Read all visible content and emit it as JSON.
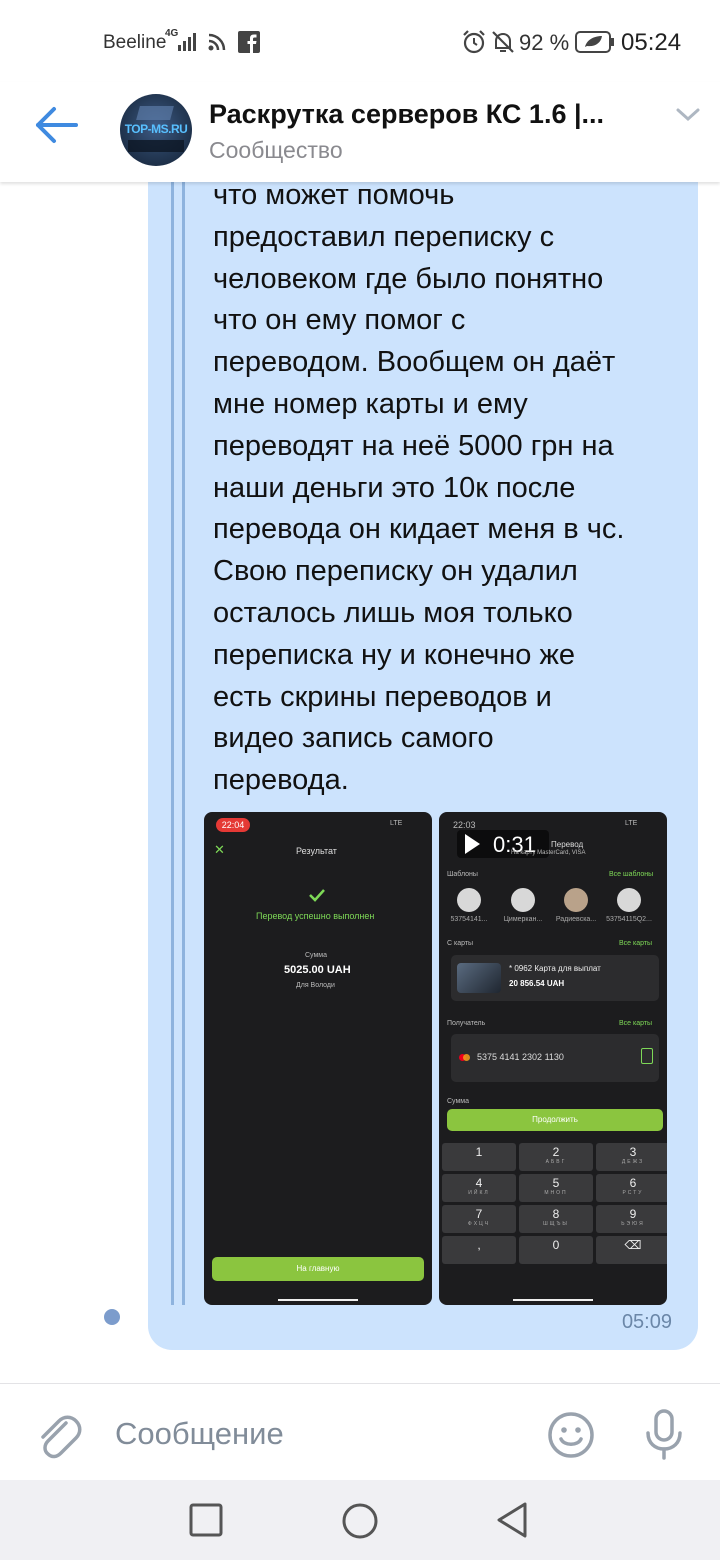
{
  "status_bar": {
    "carrier": "Beeline",
    "network": "4G",
    "battery_percent": "92 %",
    "time": "05:24",
    "icons": [
      "signal-icon",
      "wifi-icon",
      "facebook-icon",
      "alarm-icon",
      "mute-icon",
      "battery-icon"
    ]
  },
  "header": {
    "title": "Раскрутка серверов КС 1.6 |...",
    "subtitle": "Сообщество",
    "avatar_text": "TOP-MS.RU"
  },
  "message": {
    "lines": [
      "что может помочь",
      "предоставил переписку с",
      "человеком где было понятно",
      "что он ему помог с",
      "переводом. Вообщем он даёт",
      "мне номер карты и ему",
      "переводят на неё 5000 грн на",
      "наши деньги это 10к после",
      "перевода он кидает меня в чс.",
      "Свою переписку он удалил",
      "осталось лишь моя только",
      "переписка ну и конечно же",
      "есть скрины переводов и",
      "видео запись самого",
      "перевода."
    ],
    "time": "05:09"
  },
  "attachment1": {
    "status_time": "22:04",
    "status_right": "LTE",
    "title": "Результат",
    "success_text": "Перевод успешно выполнен",
    "sum_label": "Сумма",
    "amount": "5025.00 UAH",
    "recipient": "Для Володи",
    "button": "На главную"
  },
  "attachment2": {
    "status_time": "22:03",
    "status_right": "LTE",
    "video_duration": "0:31",
    "title": "Перевод",
    "subtitle": "На карту MasterCard, VISA",
    "templates_label": "Шаблоны",
    "templates_link": "Все шаблоны",
    "contacts": [
      "53754141...",
      "Цимеркан...",
      "Радиевска...",
      "53754115Q2..."
    ],
    "from_card_label": "С карты",
    "from_card_link": "Все карты",
    "card_name": "* 0962 Карта для выплат",
    "card_balance": "20 856.54 UAH",
    "recipient_label": "Получатель",
    "recipient_link": "Все карты",
    "recipient_card": "5375 4141 2302 1130",
    "sum_label": "Сумма",
    "continue_button": "Продолжить",
    "keys": [
      {
        "d": "1",
        "l": ""
      },
      {
        "d": "2",
        "l": "АБВГ"
      },
      {
        "d": "3",
        "l": "ДЕЖЗ"
      },
      {
        "d": "4",
        "l": "ИЙКЛ"
      },
      {
        "d": "5",
        "l": "МНОП"
      },
      {
        "d": "6",
        "l": "РСТУ"
      },
      {
        "d": "7",
        "l": "ФХЦЧ"
      },
      {
        "d": "8",
        "l": "ШЩЪЫ"
      },
      {
        "d": "9",
        "l": "ЬЭЮЯ"
      },
      {
        "d": ",",
        "l": ""
      },
      {
        "d": "0",
        "l": ""
      },
      {
        "d": "⌫",
        "l": ""
      }
    ]
  },
  "composer": {
    "placeholder": "Сообщение"
  },
  "colors": {
    "accent": "#3f8ae0",
    "bubble": "#cce3fd",
    "green": "#8bc53f"
  }
}
